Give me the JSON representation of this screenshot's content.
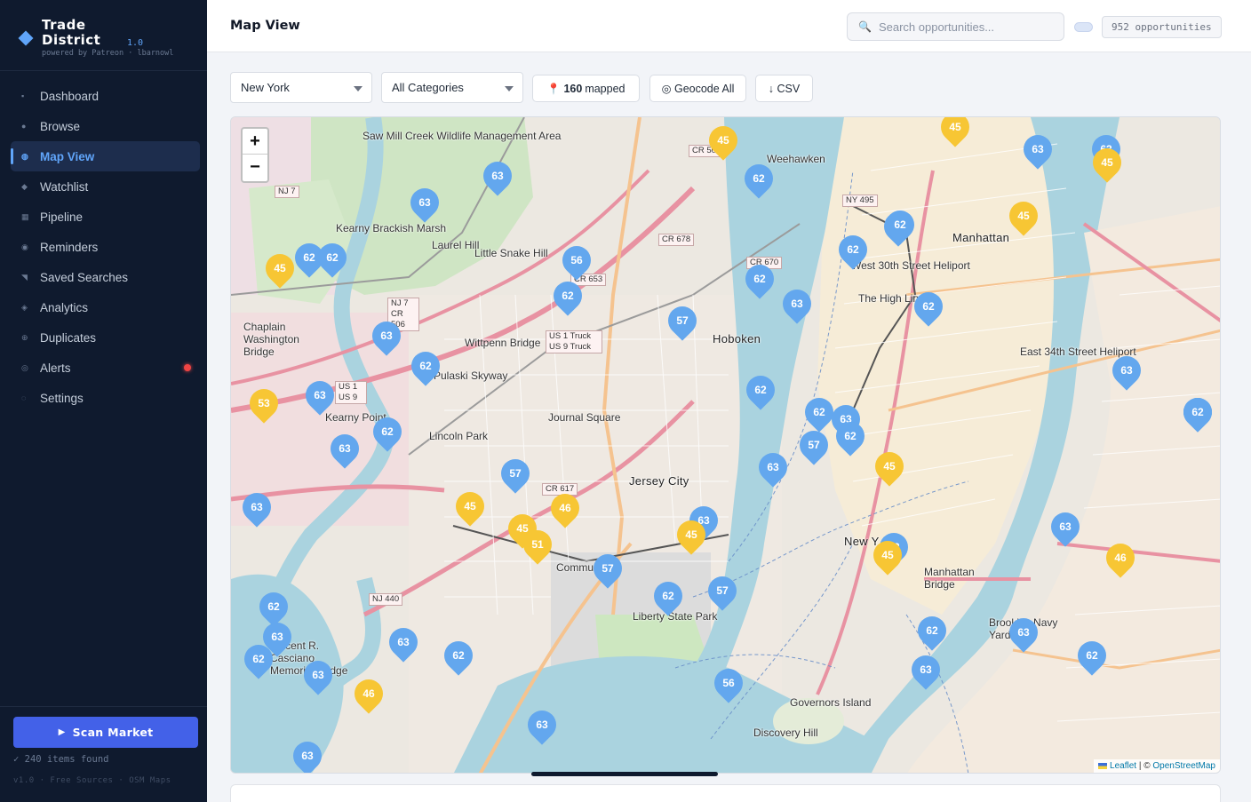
{
  "brand": {
    "name": "Trade District",
    "version": "1.0",
    "tagline": "powered by Patreon · lbarnowl"
  },
  "sidebar": {
    "items": [
      {
        "label": "Dashboard",
        "icon": "dashboard-icon",
        "glyph": "▪"
      },
      {
        "label": "Browse",
        "icon": "browse-icon",
        "glyph": "●"
      },
      {
        "label": "Map View",
        "icon": "map-icon",
        "glyph": "◍",
        "active": true
      },
      {
        "label": "Watchlist",
        "icon": "watchlist-icon",
        "glyph": "◆"
      },
      {
        "label": "Pipeline",
        "icon": "pipeline-icon",
        "glyph": "▦"
      },
      {
        "label": "Reminders",
        "icon": "clock-icon",
        "glyph": "◉"
      },
      {
        "label": "Saved Searches",
        "icon": "bookmark-icon",
        "glyph": "◥"
      },
      {
        "label": "Analytics",
        "icon": "analytics-icon",
        "glyph": "◈"
      },
      {
        "label": "Duplicates",
        "icon": "duplicates-icon",
        "glyph": "⊕"
      },
      {
        "label": "Alerts",
        "icon": "alert-icon",
        "glyph": "◎",
        "badge": true
      },
      {
        "label": "Settings",
        "icon": "settings-icon",
        "glyph": "◌"
      }
    ],
    "scan_button": "Scan Market",
    "items_found": "✓ 240 items found",
    "version_line": "v1.0 · Free Sources · OSM Maps"
  },
  "header": {
    "title": "Map View",
    "search_placeholder": "Search opportunities...",
    "count": "952 opportunities"
  },
  "toolbar": {
    "region": "New York",
    "category": "All Categories",
    "mapped_count": "160",
    "mapped_suffix": "mapped",
    "geocode": "◎ Geocode All",
    "csv": "↓ CSV"
  },
  "map": {
    "attribution_leaflet": "Leaflet",
    "attribution_sep": " | © ",
    "attribution_osm": "OpenStreetMap",
    "labels": [
      "Weehawken",
      "Manhattan",
      "Hoboken",
      "Journal Square",
      "Jersey City",
      "New Y",
      "Manhattan Bridge",
      "Brooklyn Navy Yard",
      "Liberty State Park",
      "Governors Island",
      "Discovery Hill",
      "Lincoln Park",
      "Kearny Point",
      "Chaplain Washington Bridge",
      "Pulaski Skyway",
      "Wittpenn Bridge",
      "Little Snake Hill",
      "Laurel Hill",
      "Saw Mill Creek Wildlife Management Area",
      "Kearny Brackish Marsh",
      "The High Line",
      "West 30th Street Heliport",
      "East 34th Street Heliport",
      "Vincent R. Casciano Memorial Bridge",
      "Commu"
    ],
    "colors": {
      "blue_marker": "#63a7ee",
      "yellow_marker": "#f7c634",
      "accent": "#4361e8"
    },
    "markers": [
      {
        "n": "62",
        "c": "b"
      },
      {
        "n": "62",
        "c": "b"
      },
      {
        "n": "63",
        "c": "b"
      },
      {
        "n": "63",
        "c": "b"
      },
      {
        "n": "45",
        "c": "y"
      },
      {
        "n": "45",
        "c": "y"
      },
      {
        "n": "63",
        "c": "b"
      },
      {
        "n": "45",
        "c": "y"
      },
      {
        "n": "62",
        "c": "b"
      },
      {
        "n": "62",
        "c": "b"
      },
      {
        "n": "62",
        "c": "b"
      },
      {
        "n": "45",
        "c": "y"
      },
      {
        "n": "63",
        "c": "b"
      },
      {
        "n": "62",
        "c": "b"
      },
      {
        "n": "62",
        "c": "b"
      },
      {
        "n": "45",
        "c": "y"
      },
      {
        "n": "56",
        "c": "b"
      },
      {
        "n": "62",
        "c": "b"
      },
      {
        "n": "63",
        "c": "b"
      },
      {
        "n": "62",
        "c": "b"
      },
      {
        "n": "57",
        "c": "b"
      },
      {
        "n": "63",
        "c": "b"
      },
      {
        "n": "62",
        "c": "b"
      },
      {
        "n": "63",
        "c": "b"
      },
      {
        "n": "53",
        "c": "y"
      },
      {
        "n": "63",
        "c": "b"
      },
      {
        "n": "62",
        "c": "b"
      },
      {
        "n": "63",
        "c": "b"
      },
      {
        "n": "62",
        "c": "b"
      },
      {
        "n": "62",
        "c": "b"
      },
      {
        "n": "63",
        "c": "b"
      },
      {
        "n": "62",
        "c": "b"
      },
      {
        "n": "57",
        "c": "b"
      },
      {
        "n": "63",
        "c": "b"
      },
      {
        "n": "45",
        "c": "y"
      },
      {
        "n": "57",
        "c": "b"
      },
      {
        "n": "63",
        "c": "b"
      },
      {
        "n": "62",
        "c": "b"
      },
      {
        "n": "45",
        "c": "y"
      },
      {
        "n": "46",
        "c": "y"
      },
      {
        "n": "45",
        "c": "y"
      },
      {
        "n": "51",
        "c": "y"
      },
      {
        "n": "63",
        "c": "b"
      },
      {
        "n": "45",
        "c": "y"
      },
      {
        "n": "63",
        "c": "b"
      },
      {
        "n": "63",
        "c": "b"
      },
      {
        "n": "45",
        "c": "y"
      },
      {
        "n": "46",
        "c": "y"
      },
      {
        "n": "57",
        "c": "b"
      },
      {
        "n": "62",
        "c": "b"
      },
      {
        "n": "57",
        "c": "b"
      },
      {
        "n": "62",
        "c": "b"
      },
      {
        "n": "63",
        "c": "b"
      },
      {
        "n": "62",
        "c": "b"
      },
      {
        "n": "63",
        "c": "b"
      },
      {
        "n": "63",
        "c": "b"
      },
      {
        "n": "62",
        "c": "b"
      },
      {
        "n": "62",
        "c": "b"
      },
      {
        "n": "63",
        "c": "b"
      },
      {
        "n": "62",
        "c": "b"
      },
      {
        "n": "63",
        "c": "b"
      },
      {
        "n": "46",
        "c": "y"
      },
      {
        "n": "56",
        "c": "b"
      },
      {
        "n": "63",
        "c": "b"
      },
      {
        "n": "63",
        "c": "b"
      },
      {
        "n": "63",
        "c": "b"
      },
      {
        "n": "63",
        "c": "b"
      },
      {
        "n": "62",
        "c": "b"
      }
    ],
    "road_tags": [
      "NJ 7",
      "NJ 7 CR 506",
      "US 1 Truck US 9 Truck",
      "US 1 US 9",
      "CR 678",
      "CR 670",
      "NY 495",
      "CR 617",
      "NJ 440",
      "CR 653",
      "CR 50"
    ]
  }
}
